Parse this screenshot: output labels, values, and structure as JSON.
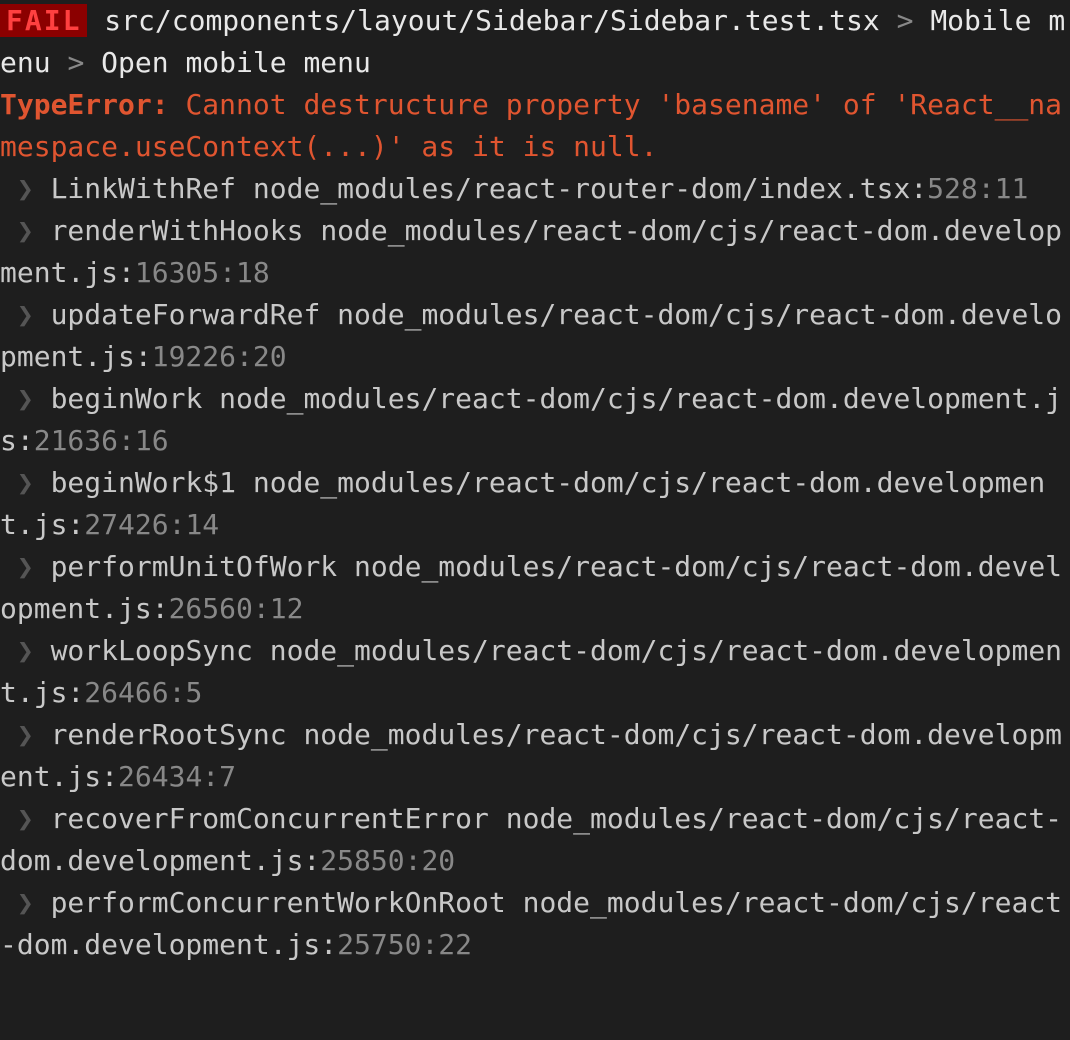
{
  "status": {
    "label": "FAIL"
  },
  "testFile": "src/components/layout/Sidebar/Sidebar.test.tsx",
  "breadcrumb": {
    "sep": ">",
    "suite": "Mobile menu",
    "test": "Open mobile menu"
  },
  "error": {
    "type": "TypeError:",
    "message": "Cannot destructure property 'basename' of 'React__namespace.useContext(...)' as it is null."
  },
  "arrow": "❯",
  "stack": [
    {
      "func": "LinkWithRef",
      "file": "node_modules/react-router-dom/index.tsx:",
      "loc": "528:11"
    },
    {
      "func": "renderWithHooks",
      "file": "node_modules/react-dom/cjs/react-dom.development.js:",
      "loc": "16305:18"
    },
    {
      "func": "updateForwardRef",
      "file": "node_modules/react-dom/cjs/react-dom.development.js:",
      "loc": "19226:20"
    },
    {
      "func": "beginWork",
      "file": "node_modules/react-dom/cjs/react-dom.development.js:",
      "loc": "21636:16"
    },
    {
      "func": "beginWork$1",
      "file": "node_modules/react-dom/cjs/react-dom.development.js:",
      "loc": "27426:14"
    },
    {
      "func": "performUnitOfWork",
      "file": "node_modules/react-dom/cjs/react-dom.development.js:",
      "loc": "26560:12"
    },
    {
      "func": "workLoopSync",
      "file": "node_modules/react-dom/cjs/react-dom.development.js:",
      "loc": "26466:5"
    },
    {
      "func": "renderRootSync",
      "file": "node_modules/react-dom/cjs/react-dom.development.js:",
      "loc": "26434:7"
    },
    {
      "func": "recoverFromConcurrentError",
      "file": "node_modules/react-dom/cjs/react-dom.development.js:",
      "loc": "25850:20"
    },
    {
      "func": "performConcurrentWorkOnRoot",
      "file": "node_modules/react-dom/cjs/react-dom.development.js:",
      "loc": "25750:22"
    }
  ]
}
